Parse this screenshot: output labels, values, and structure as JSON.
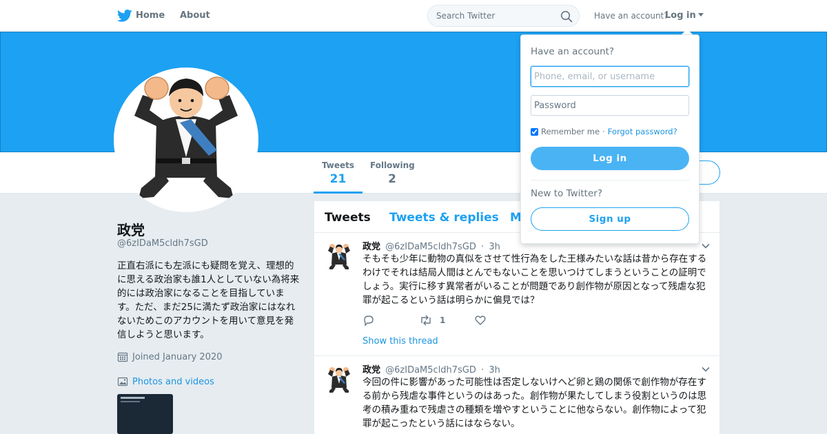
{
  "nav": {
    "home": "Home",
    "about": "About",
    "search_placeholder": "Search Twitter",
    "have_account": "Have an account?",
    "login": "Log in"
  },
  "profile": {
    "name": "政党",
    "handle": "@6zIDaM5cldh7sGD",
    "bio": "正直右派にも左派にも疑問を覚え、理想的に思える政治家も誰1人としていない為将来的には政治家になることを目指しています。ただ、まだ25に満たず政治家にはなれないためこのアカウントを用いて意見を発信しようと思います。",
    "joined": "Joined January 2020",
    "photos_videos": "Photos and videos"
  },
  "stats": [
    {
      "label": "Tweets",
      "value": "21"
    },
    {
      "label": "Following",
      "value": "2"
    }
  ],
  "timeline": {
    "tabs": [
      "Tweets",
      "Tweets & replies",
      "M"
    ],
    "tweets": [
      {
        "name": "政党",
        "handle": "@6zIDaM5cldh7sGD",
        "time": "3h",
        "text": "そもそも少年に動物の真似をさせて性行為をした王様みたいな話は昔から存在するわけでそれは結局人間はとんでもないことを思いつけてしまうということの証明でしょう。実行に移す異常者がいることが問題であり創作物が原因となって残虐な犯罪が起こるという話は明らかに偏見では？",
        "retweets": "1",
        "thread_link": "Show this thread"
      },
      {
        "name": "政党",
        "handle": "@6zIDaM5cldh7sGD",
        "time": "3h",
        "text": "今回の件に影響があった可能性は否定しないけへど卵と鶏の関係で創作物が存在する前から残虐な事件というのはあった。創作物が果たしてしまう役割というのは思考の積み重ねで残虐さの種類を増やすということに他ならない。創作物によって犯罪が起こったという話にはならない。"
      }
    ]
  },
  "login_dropdown": {
    "title": "Have an account?",
    "username_placeholder": "Phone, email, or username",
    "password_placeholder": "Password",
    "remember_me": "Remember me",
    "separator": "·",
    "forgot": "Forgot password?",
    "login_button": "Log in",
    "new_to": "New to Twitter?",
    "signup_button": "Sign up"
  },
  "colors": {
    "brand": "#1da1f2",
    "link": "#1b95e0",
    "muted": "#657786"
  },
  "icons": [
    "twitter-bird-icon",
    "search-icon",
    "caret-down-icon",
    "calendar-icon",
    "photo-icon",
    "reply-icon",
    "retweet-icon",
    "like-icon",
    "chevron-down-icon"
  ]
}
